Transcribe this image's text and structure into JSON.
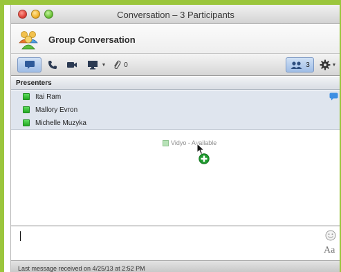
{
  "window": {
    "title": "Conversation – 3 Participants"
  },
  "header": {
    "title": "Group Conversation"
  },
  "toolbar": {
    "attachment_count": "0",
    "participant_count": "3"
  },
  "presenters": {
    "title": "Presenters",
    "items": [
      {
        "name": "Itai Ram",
        "status_color": "#2fbf2f",
        "has_chat_icon": true
      },
      {
        "name": "Mallory Evron",
        "status_color": "#2fbf2f"
      },
      {
        "name": "Michelle Muzyka",
        "status_color": "#2fbf2f"
      }
    ]
  },
  "drag_item": {
    "label": "Vidyo - Available"
  },
  "composer": {
    "value": "",
    "font_label": "Aa"
  },
  "status_bar": {
    "text": "Last message received on 4/25/13 at 2:52 PM"
  },
  "colors": {
    "accent_green": "#9bc63c",
    "selection_blue": "#9fbde6"
  },
  "icons": {
    "chat": "chat-bubble-icon",
    "phone": "phone-icon",
    "video": "video-camera-icon",
    "screen": "screen-share-icon",
    "attachment": "paperclip-icon",
    "participants": "people-icon",
    "settings": "gear-icon",
    "emoji": "smiley-icon",
    "add": "plus-icon"
  }
}
